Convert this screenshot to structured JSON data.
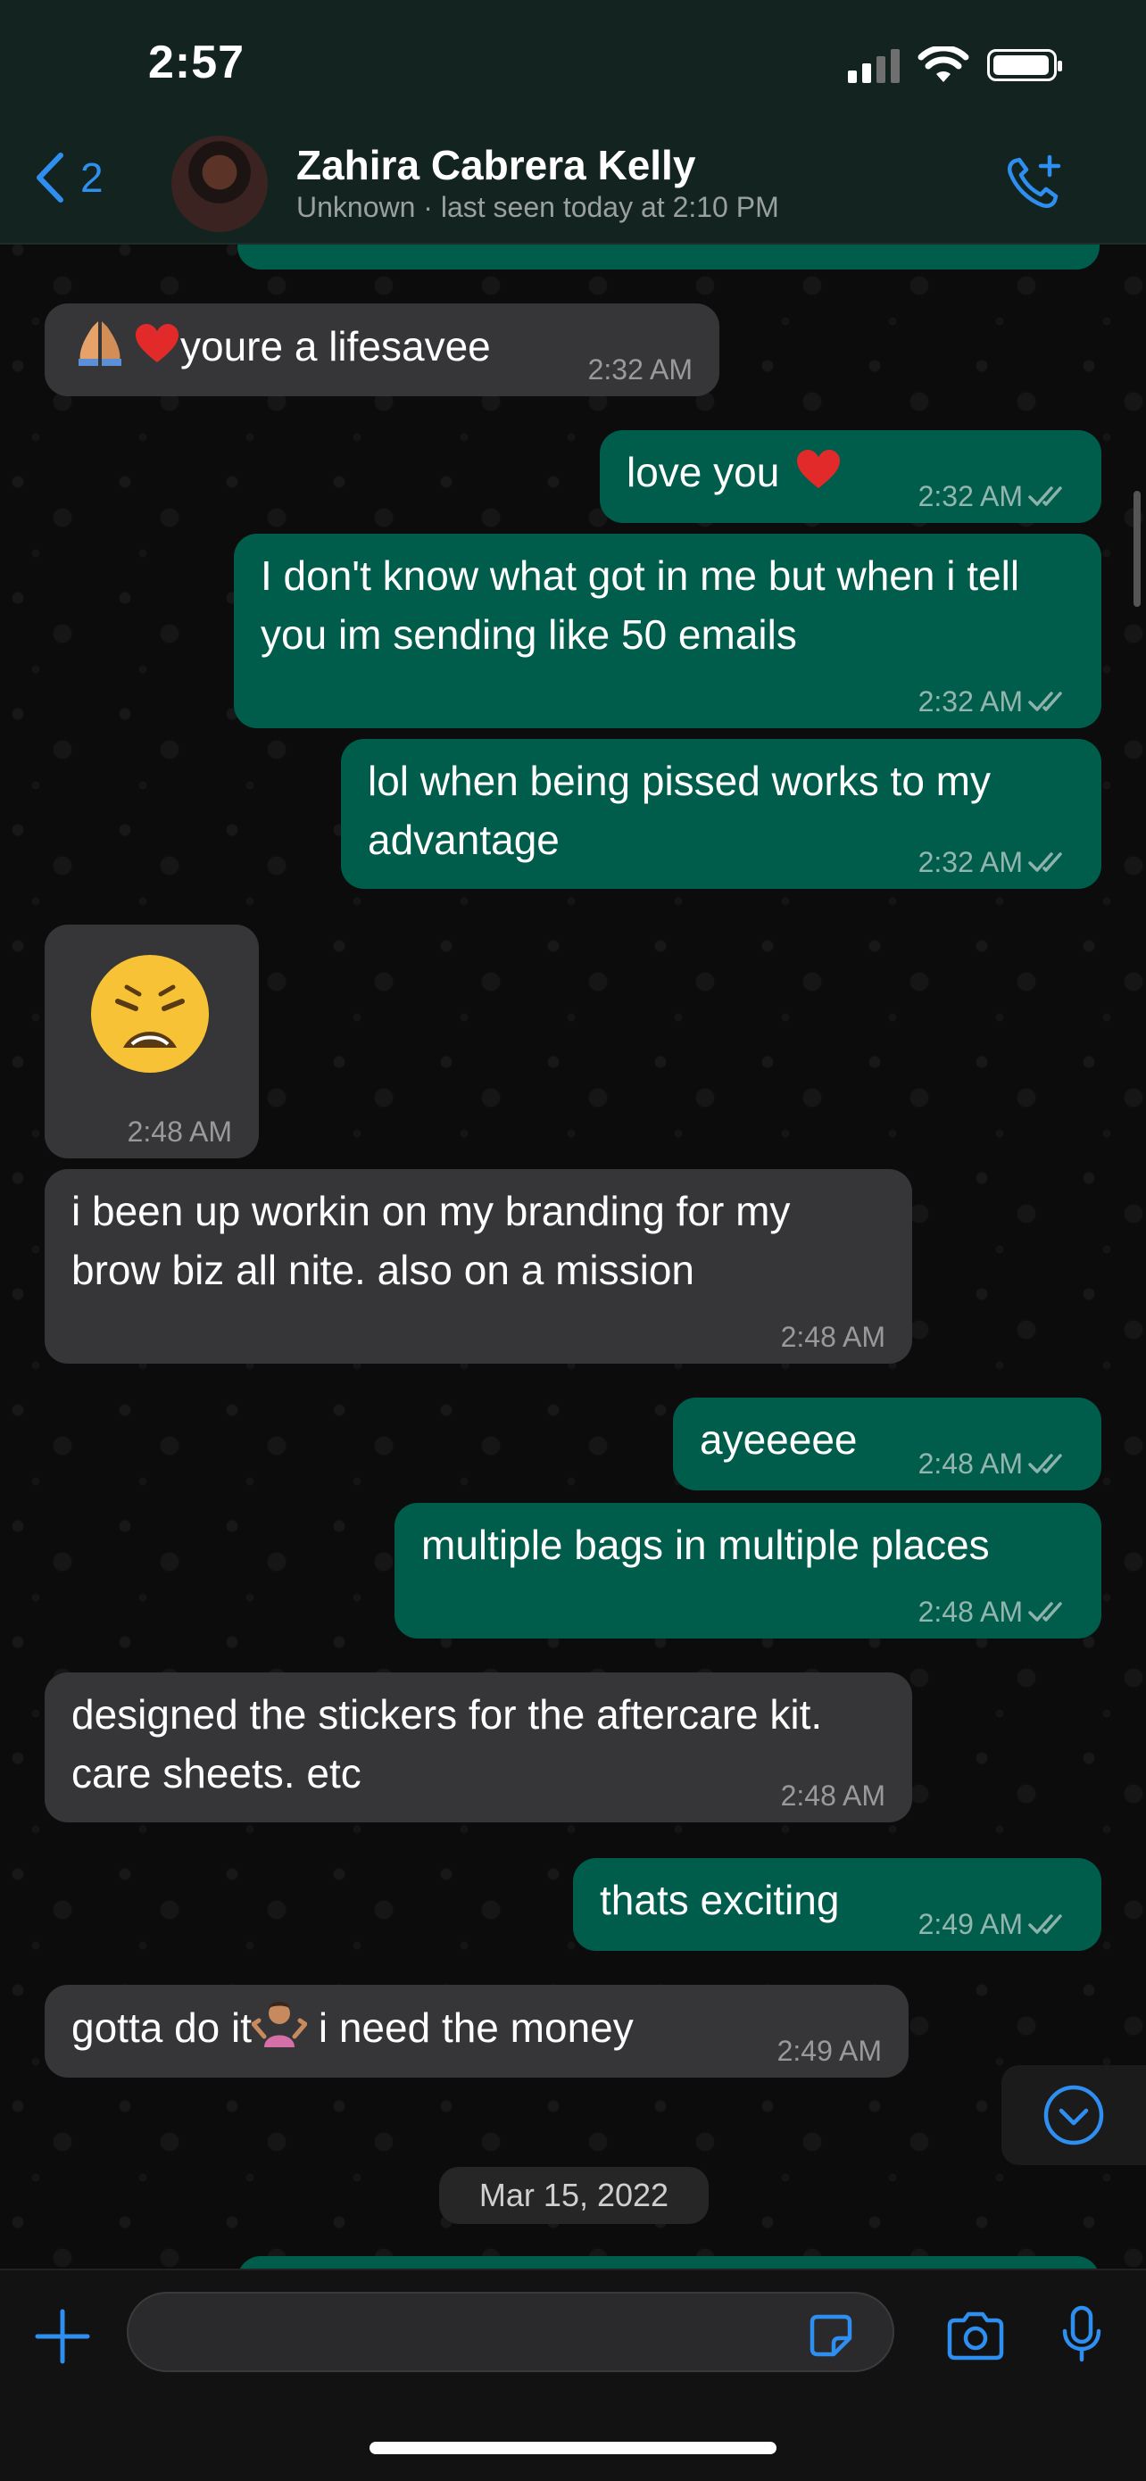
{
  "status_bar": {
    "time": "2:57"
  },
  "header": {
    "back_count": "2",
    "contact_name": "Zahira Cabrera Kelly",
    "contact_status": "Unknown  · last seen today at 2:10 PM"
  },
  "messages": [
    {
      "dir": "in",
      "text": "youre a lifesavee",
      "time": "2:32 AM"
    },
    {
      "dir": "out",
      "text": "love you",
      "time": "2:32 AM"
    },
    {
      "dir": "out",
      "text": "I don't know what got in me but when i tell you im sending like 50 emails",
      "time": "2:32 AM"
    },
    {
      "dir": "out",
      "text": "lol when being pissed works to my advantage",
      "time": "2:32 AM"
    },
    {
      "dir": "in",
      "text": "",
      "time": "2:48 AM"
    },
    {
      "dir": "in",
      "text": "i been up workin on my branding for my brow biz all nite. also on a mission",
      "time": "2:48 AM"
    },
    {
      "dir": "out",
      "text": "ayeeeee",
      "time": "2:48 AM"
    },
    {
      "dir": "out",
      "text": "multiple bags in multiple places",
      "time": "2:48 AM"
    },
    {
      "dir": "in",
      "text": "designed the stickers for the aftercare kit. care sheets. etc",
      "time": "2:48 AM"
    },
    {
      "dir": "out",
      "text": "thats exciting",
      "time": "2:49 AM"
    },
    {
      "dir": "in",
      "text_before": "gotta do it",
      "text_after": "i need the money",
      "time": "2:49 AM"
    }
  ],
  "date_divider": "Mar 15, 2022",
  "colors": {
    "accent": "#2e8ff0",
    "outgoing": "#005c4b",
    "incoming": "#363638"
  }
}
